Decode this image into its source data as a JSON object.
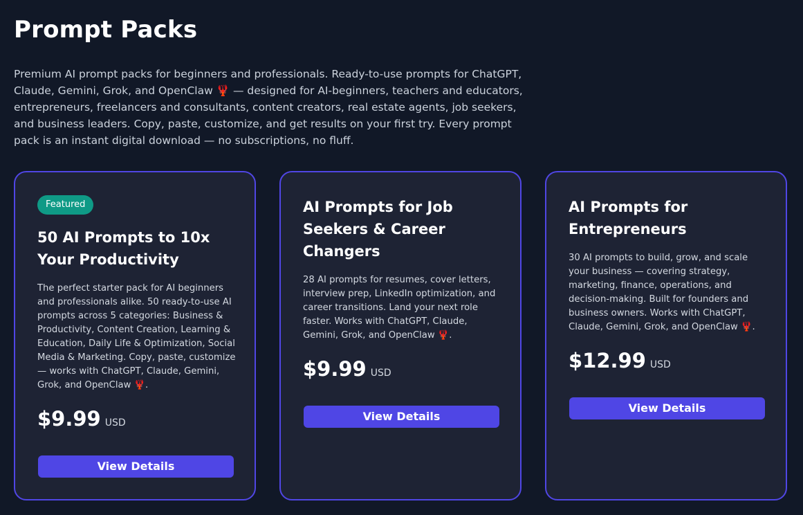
{
  "page": {
    "title": "Prompt Packs",
    "intro_part1": "Premium AI prompt packs for beginners and professionals. Ready-to-use prompts for ChatGPT, Claude, Gemini, Grok, and OpenClaw ",
    "intro_emoji": "🦞",
    "intro_part2": " — designed for AI-beginners, teachers and educators, entrepreneurs, freelancers and consultants, content creators, real estate agents, job seekers, and business leaders. Copy, paste, customize, and get results on your first try. Every prompt pack is an instant digital download — no subscriptions, no fluff."
  },
  "products": [
    {
      "badge": "Featured",
      "title": "50 AI Prompts to 10x Your Productivity",
      "description_main": "The perfect starter pack for AI beginners and professionals alike. 50 ready-to-use AI prompts across 5 categories: Business & Productivity, Content Creation, Learning & Education, Daily Life & Optimization, Social Media & Marketing. Copy, paste, customize — works with ChatGPT, Claude, Gemini, Grok, and OpenClaw ",
      "description_emoji": "🦞",
      "description_end": ".",
      "price": "$9.99",
      "currency": "USD",
      "button_label": "View Details"
    },
    {
      "badge": "",
      "title": "AI Prompts for Job Seekers & Career Changers",
      "description_main": "28 AI prompts for resumes, cover letters, interview prep, LinkedIn optimization, and career transitions. Land your next role faster. Works with ChatGPT, Claude, Gemini, Grok, and OpenClaw ",
      "description_emoji": "🦞",
      "description_end": ".",
      "price": "$9.99",
      "currency": "USD",
      "button_label": "View Details"
    },
    {
      "badge": "",
      "title": "AI Prompts for Entrepreneurs",
      "description_main": "30 AI prompts to build, grow, and scale your business — covering strategy, marketing, finance, operations, and decision-making. Built for founders and business owners. Works with ChatGPT, Claude, Gemini, Grok, and OpenClaw ",
      "description_emoji": "🦞",
      "description_end": ".",
      "price": "$12.99",
      "currency": "USD",
      "button_label": "View Details"
    }
  ],
  "colors": {
    "background": "#111827",
    "card_background": "#1e2334",
    "card_border": "#5046e5",
    "button": "#4f46e5",
    "badge": "#0f9a86",
    "lobster": "#e11d48"
  }
}
